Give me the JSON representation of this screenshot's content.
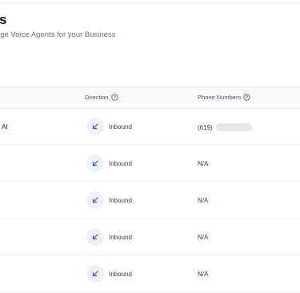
{
  "header": {
    "title": "s",
    "subtitle": "age Voice Agents for your Business"
  },
  "table": {
    "columns": {
      "direction": "Direction",
      "phone_numbers": "Phone Numbers"
    },
    "rows": [
      {
        "name": "AI",
        "direction": "Inbound",
        "phone": "(619)"
      },
      {
        "name": "",
        "direction": "Inbound",
        "phone": "N/A"
      },
      {
        "name": "",
        "direction": "Inbound",
        "phone": "N/A"
      },
      {
        "name": "",
        "direction": "Inbound",
        "phone": "N/A"
      },
      {
        "name": "",
        "direction": "Inbound",
        "phone": "N/A"
      }
    ]
  },
  "icons": {
    "help": "help-circle-icon",
    "direction": "arrow-down-left-icon"
  },
  "colors": {
    "accent_icon": "#2f5bd6",
    "badge_bg": "#eef1f5"
  }
}
